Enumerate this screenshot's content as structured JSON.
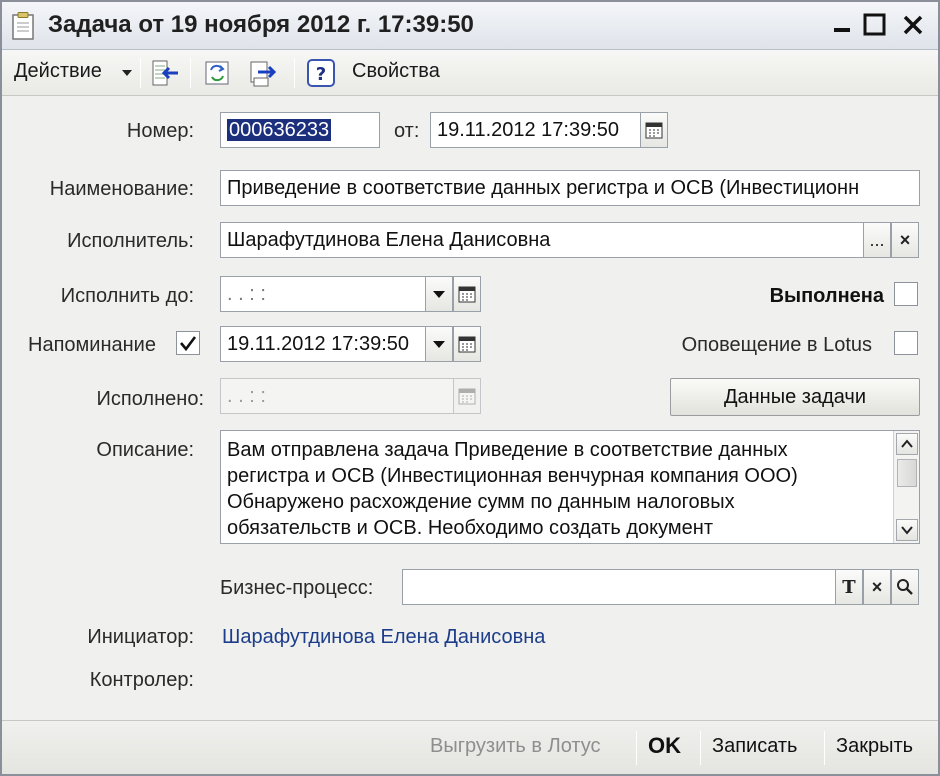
{
  "window": {
    "title": "Задача от 19 ноября 2012 г. 17:39:50"
  },
  "toolbar": {
    "action_menu": "Действие",
    "help_glyph": "?",
    "properties": "Свойства"
  },
  "form": {
    "number_label": "Номер:",
    "number_value": "000636233",
    "date_label": "от:",
    "date_value": "19.11.2012 17:39:50",
    "name_label": "Наименование:",
    "name_value": "Приведение в соответствие данных регистра и ОСВ (Инвестиционн",
    "executor_label": "Исполнитель:",
    "executor_value": "Шарафутдинова Елена Данисовна",
    "executor_select_glyph": "...",
    "executor_clear_glyph": "×",
    "due_label": "Исполнить до:",
    "due_value": " .  .       :  :",
    "done_flag_label": "Выполнена",
    "done_flag_checked": false,
    "reminder_label": "Напоминание",
    "reminder_checked": true,
    "reminder_value": "19.11.2012 17:39:50",
    "lotus_label": "Оповещение в Lotus",
    "lotus_checked": false,
    "completed_label": "Исполнено:",
    "completed_value": " .  .       :  :",
    "task_data_button": "Данные задачи",
    "description_label": "Описание:",
    "description_lines": [
      "Вам отправлена задача Приведение в соответствие данных",
      "регистра и ОСВ (Инвестиционная венчурная компания ООО)",
      "Обнаружено расхождение сумм по данным налоговых",
      "обязательств и ОСВ. Необходимо создать документ"
    ],
    "business_process_label": "Бизнес-процесс:",
    "business_process_value": "",
    "bp_type_glyph": "T",
    "bp_clear_glyph": "×",
    "initiator_label": "Инициатор:",
    "initiator_value": "Шарафутдинова Елена Данисовна",
    "controller_label": "Контролер:",
    "controller_value": ""
  },
  "footer": {
    "export_lotus": "Выгрузить в Лотус",
    "ok": "OK",
    "save": "Записать",
    "close": "Закрыть"
  },
  "colors": {
    "selection": "#1c2f7d",
    "link": "#1c3d8a",
    "window_bg": "#f0f0ee"
  }
}
